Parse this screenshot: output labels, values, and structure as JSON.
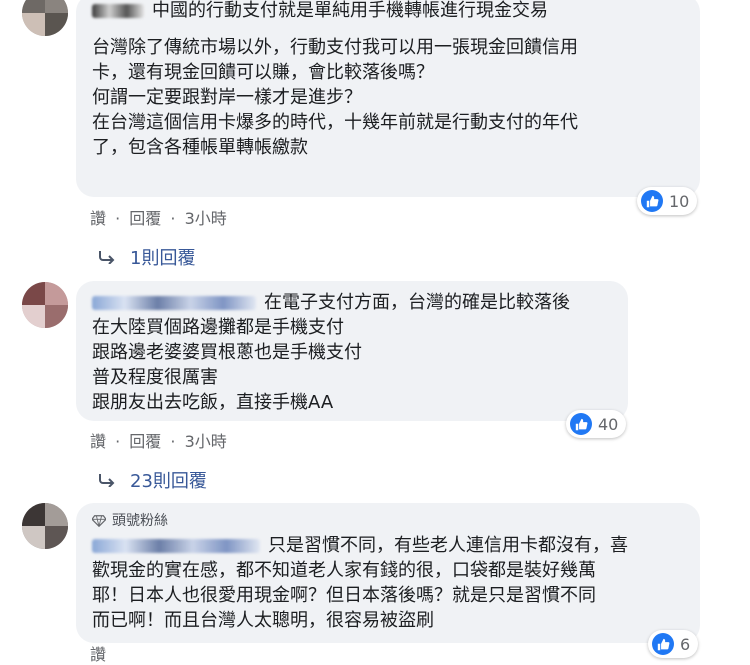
{
  "comments": [
    {
      "first_line": "中國的行動支付就是單純用手機轉帳進行現金交易",
      "paragraphs": [
        [
          "台灣除了傳統市場以外，行動支付我可以用一張現金回饋信用",
          "卡，還有現金回饋可以賺，會比較落後嗎？"
        ],
        [
          "何謂一定要跟對岸一樣才是進步？"
        ],
        [
          "在台灣這個信用卡爆多的時代，十幾年前就是行動支付的年代",
          "了，包含各種帳單轉帳繳款"
        ]
      ],
      "like_action": "讚",
      "reply_action": "回覆",
      "time": "3小時",
      "like_count": "10",
      "replies_label": "1則回覆"
    },
    {
      "first_line": "在電子支付方面，台灣的確是比較落後",
      "lines": [
        "在大陸買個路邊攤都是手機支付",
        "跟路邊老婆婆買根蔥也是手機支付",
        "普及程度很厲害",
        "跟朋友出去吃飯，直接手機AA"
      ],
      "like_action": "讚",
      "reply_action": "回覆",
      "time": "3小時",
      "like_count": "40",
      "replies_label": "23則回覆"
    },
    {
      "badge": "頭號粉絲",
      "first_line": "只是習慣不同，有些老人連信用卡都沒有，喜",
      "lines": [
        "歡現金的實在感，都不知道老人家有錢的很，口袋都是裝好幾萬",
        "耶！日本人也很愛用現金啊？但日本落後嗎？就是只是習慣不同",
        "而已啊！而且台灣人太聰明，很容易被盜刷"
      ],
      "like_action": "讚",
      "like_count": "6"
    }
  ],
  "separator": "·",
  "colors": {
    "like_blue": "#2078f4",
    "bubble_bg": "#f0f2f5",
    "meta_gray": "#65676b",
    "reply_link": "#385898"
  }
}
